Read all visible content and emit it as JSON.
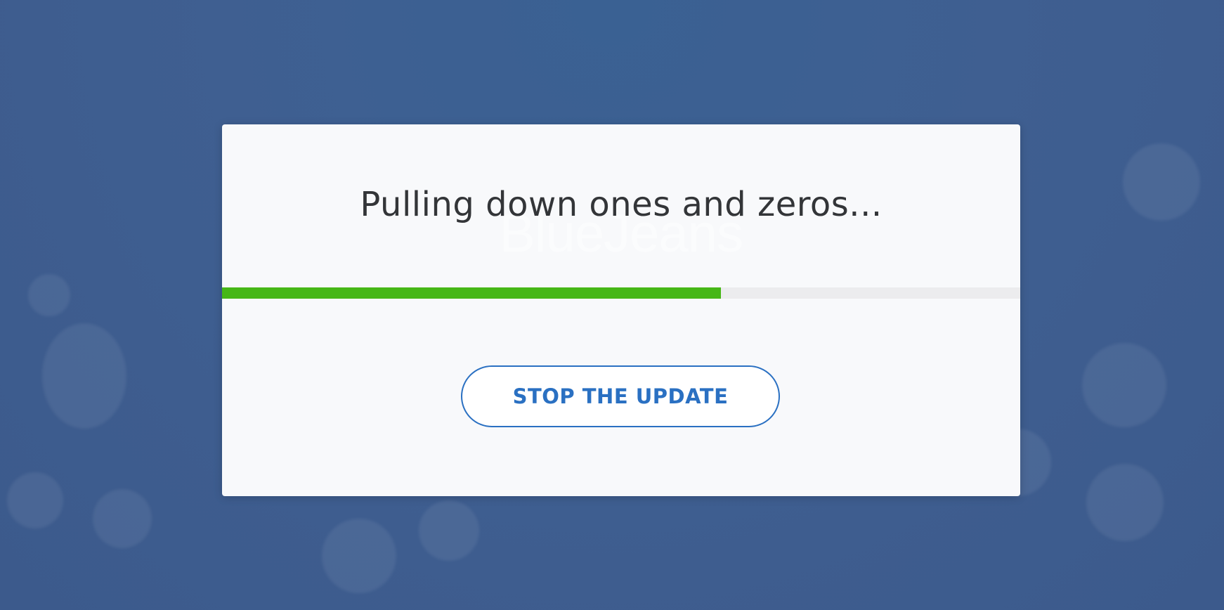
{
  "background": {
    "color": "#3f5f91"
  },
  "dialog": {
    "watermark_text": "BlueJeans",
    "title": "Pulling down ones and zeros...",
    "progress": {
      "fraction": 0.625,
      "fill_color": "#46b716",
      "track_color": "#ececee"
    },
    "stop_button_label": "STOP THE UPDATE",
    "button_color": "#2a70c2"
  }
}
